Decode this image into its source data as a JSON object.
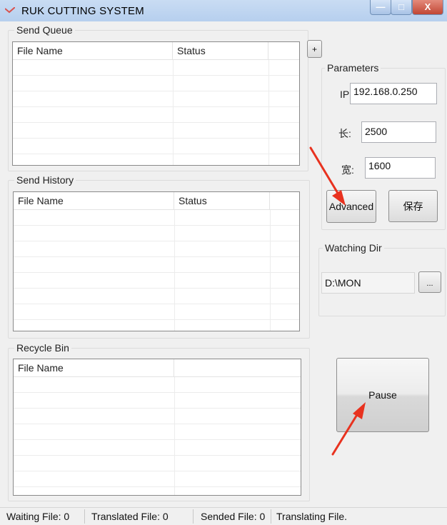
{
  "window": {
    "title": "RUK CUTTING SYSTEM",
    "min_glyph": "—",
    "max_glyph": "□",
    "close_glyph": "X"
  },
  "send_queue": {
    "title": "Send Queue",
    "columns": [
      "File Name",
      "Status"
    ],
    "add_label": "+"
  },
  "send_history": {
    "title": "Send History",
    "columns": [
      "File Name",
      "Status"
    ]
  },
  "recycle_bin": {
    "title": "Recycle Bin",
    "columns": [
      "File Name"
    ]
  },
  "parameters": {
    "title": "Parameters",
    "ip_label": "IP",
    "ip_value": "192.168.0.250",
    "length_label": "长:",
    "length_value": "2500",
    "width_label": "宽:",
    "width_value": "1600",
    "advanced_label": "Advanced",
    "save_label": "保存"
  },
  "watching_dir": {
    "title": "Watching Dir",
    "path": "D:\\MON",
    "browse_label": "..."
  },
  "pause_label": "Pause",
  "status_bar": {
    "waiting": "Waiting File: 0",
    "translated": "Translated File: 0",
    "sended": "Sended File: 0",
    "translating": "Translating File."
  },
  "colors": {
    "annotation_arrow": "#e8321f",
    "titlebar": "#c9dcf3",
    "close_button": "#c14634"
  }
}
